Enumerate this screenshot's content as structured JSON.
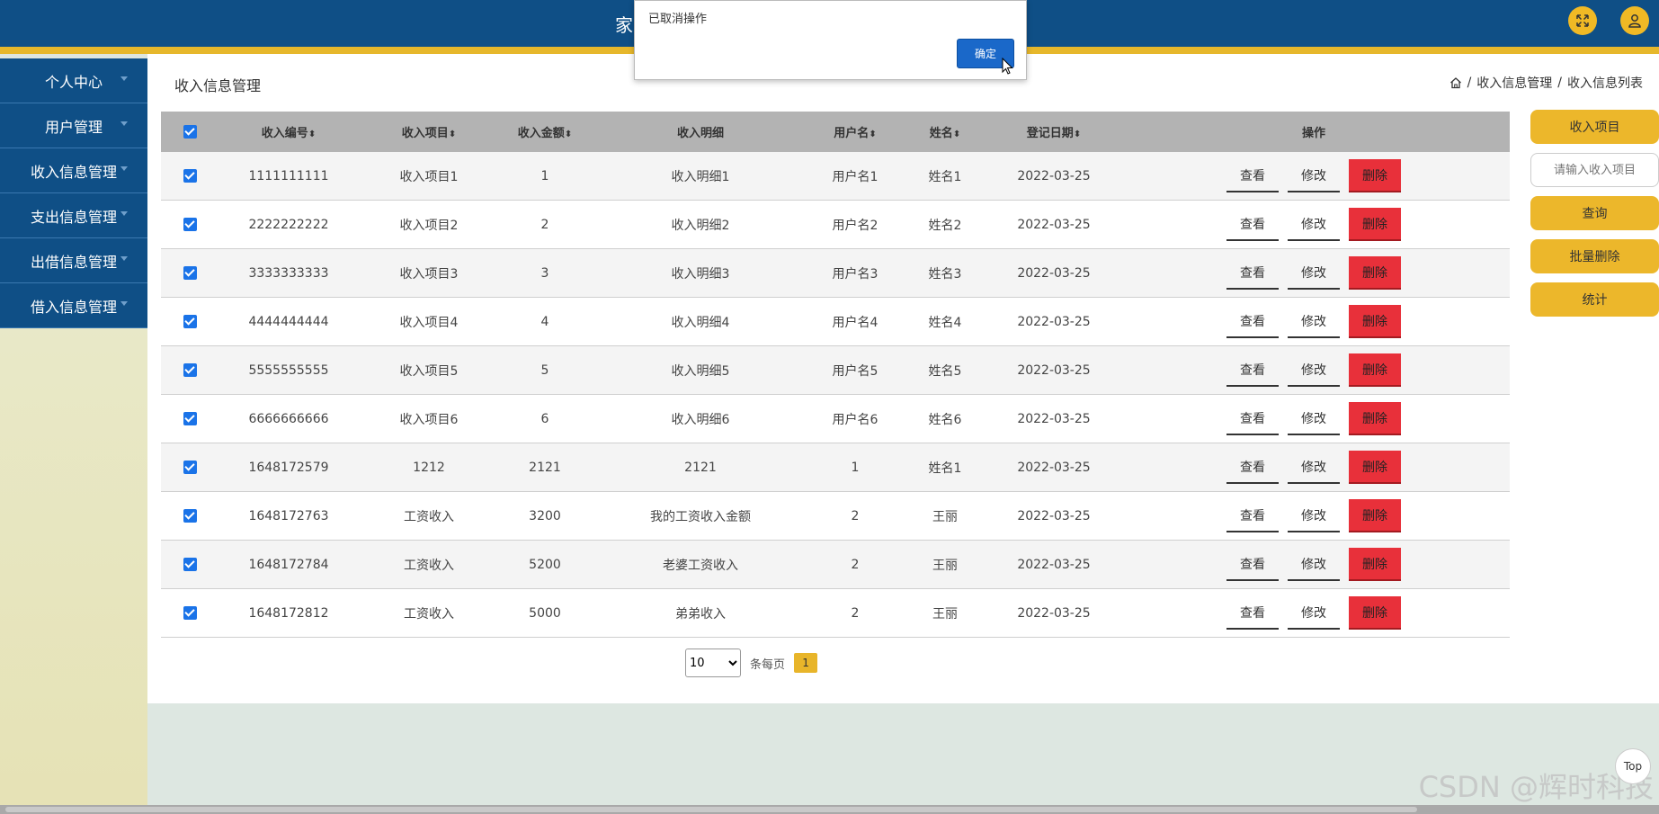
{
  "header": {
    "title": "家",
    "fullscreen_icon": "fullscreen-icon",
    "user_icon": "user-icon"
  },
  "sidebar": {
    "items": [
      {
        "label": "个人中心"
      },
      {
        "label": "用户管理"
      },
      {
        "label": "收入信息管理"
      },
      {
        "label": "支出信息管理"
      },
      {
        "label": "出借信息管理"
      },
      {
        "label": "借入信息管理"
      }
    ]
  },
  "page": {
    "title": "收入信息管理",
    "breadcrumb": [
      "收入信息管理",
      "收入信息列表"
    ],
    "breadcrumb_sep": "/"
  },
  "table": {
    "columns": [
      "收入编号",
      "收入项目",
      "收入金额",
      "收入明细",
      "用户名",
      "姓名",
      "登记日期",
      "操作"
    ],
    "sortable": [
      true,
      true,
      true,
      false,
      true,
      true,
      true,
      false
    ],
    "rows": [
      [
        "1111111111",
        "收入项目1",
        "1",
        "收入明细1",
        "用户名1",
        "姓名1",
        "2022-03-25"
      ],
      [
        "2222222222",
        "收入项目2",
        "2",
        "收入明细2",
        "用户名2",
        "姓名2",
        "2022-03-25"
      ],
      [
        "3333333333",
        "收入项目3",
        "3",
        "收入明细3",
        "用户名3",
        "姓名3",
        "2022-03-25"
      ],
      [
        "4444444444",
        "收入项目4",
        "4",
        "收入明细4",
        "用户名4",
        "姓名4",
        "2022-03-25"
      ],
      [
        "5555555555",
        "收入项目5",
        "5",
        "收入明细5",
        "用户名5",
        "姓名5",
        "2022-03-25"
      ],
      [
        "6666666666",
        "收入项目6",
        "6",
        "收入明细6",
        "用户名6",
        "姓名6",
        "2022-03-25"
      ],
      [
        "1648172579",
        "1212",
        "2121",
        "2121",
        "1",
        "姓名1",
        "2022-03-25"
      ],
      [
        "1648172763",
        "工资收入",
        "3200",
        "我的工资收入金额",
        "2",
        "王丽",
        "2022-03-25"
      ],
      [
        "1648172784",
        "工资收入",
        "5200",
        "老婆工资收入",
        "2",
        "王丽",
        "2022-03-25"
      ],
      [
        "1648172812",
        "工资收入",
        "5000",
        "弟弟收入",
        "2",
        "王丽",
        "2022-03-25"
      ]
    ],
    "row_actions": {
      "view": "查看",
      "edit": "修改",
      "delete": "删除"
    }
  },
  "pagination": {
    "page_size": "10",
    "page_size_options": [
      "10"
    ],
    "per_page_label": "条每页",
    "current_page": "1"
  },
  "actions": {
    "income_item_button": "收入项目",
    "search_placeholder": "请输入收入项目",
    "query_button": "查询",
    "batch_delete_button": "批量删除",
    "stats_button": "统计"
  },
  "dialog": {
    "message": "已取消操作",
    "ok_label": "确定"
  },
  "footer": {
    "top_label": "Top",
    "watermark": "CSDN @辉时科技"
  },
  "colors": {
    "header_blue": "#0f4f86",
    "accent_gold": "#e6b72b",
    "delete_red": "#e8303a",
    "checkbox_blue": "#1a73e8"
  }
}
